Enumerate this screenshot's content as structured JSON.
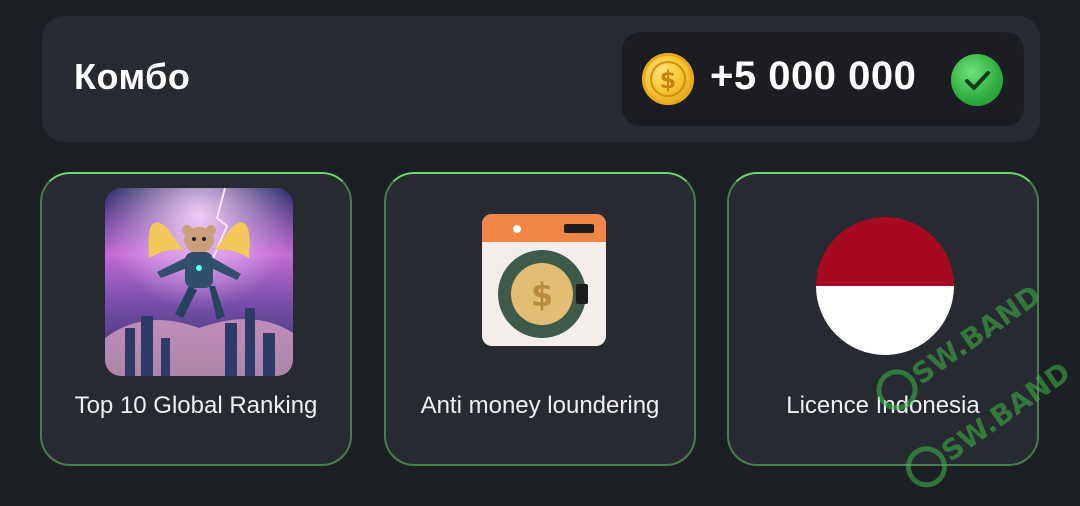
{
  "header": {
    "title": "Комбо",
    "reward_amount": "+5 000 000",
    "reward_icon": "coin-icon",
    "status_icon": "check-icon"
  },
  "cards": [
    {
      "label": "Top 10 Global Ranking",
      "icon": "hamster-astronaut-image"
    },
    {
      "label": "Anti money loundering",
      "icon": "washing-machine-coin-icon"
    },
    {
      "label": "Licence Indonesia",
      "icon": "indonesia-flag-icon"
    }
  ],
  "colors": {
    "background": "#1c1f24",
    "panel": "#272a31",
    "pill": "#1b1d22",
    "card_border": "#6cd36f",
    "coin": "#f6c32c",
    "check": "#32b144",
    "flag_red": "#a50a21",
    "flag_white": "#ffffff"
  },
  "watermark": {
    "text": "SW.BAND"
  }
}
